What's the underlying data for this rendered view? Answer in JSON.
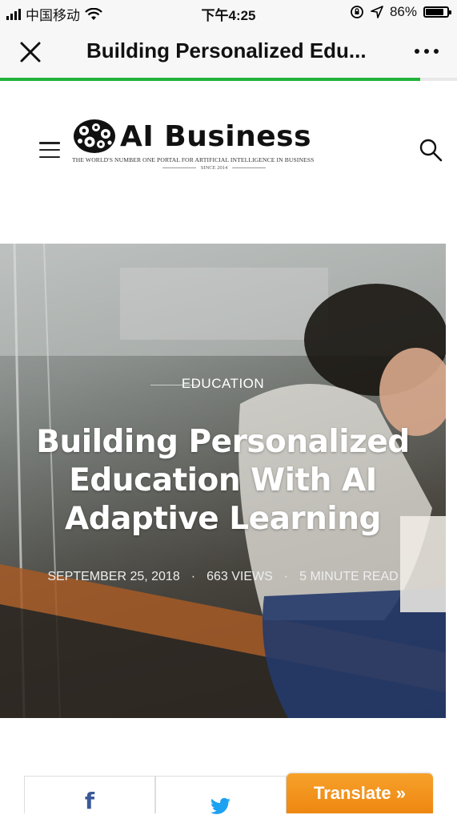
{
  "status_bar": {
    "carrier": "中国移动",
    "time": "下午4:25",
    "battery_percent": "86%",
    "battery_level": 0.86
  },
  "nav": {
    "title": "Building Personalized Edu...",
    "load_progress": 0.92,
    "accent_color": "#22b33a"
  },
  "site": {
    "logo_text": "AI Business",
    "tagline": "THE WORLD'S NUMBER ONE PORTAL FOR ARTIFICIAL INTELLIGENCE IN BUSINESS",
    "since": "SINCE 2014"
  },
  "article": {
    "category": "EDUCATION",
    "title": "Building Personalized Education With AI Adaptive Learning",
    "date": "SEPTEMBER 25, 2018",
    "views": "663 VIEWS",
    "read_time": "5 MINUTE READ"
  },
  "share": {
    "facebook_icon": "f",
    "translate_label": "Translate »",
    "translate_color": "#ee8712"
  }
}
